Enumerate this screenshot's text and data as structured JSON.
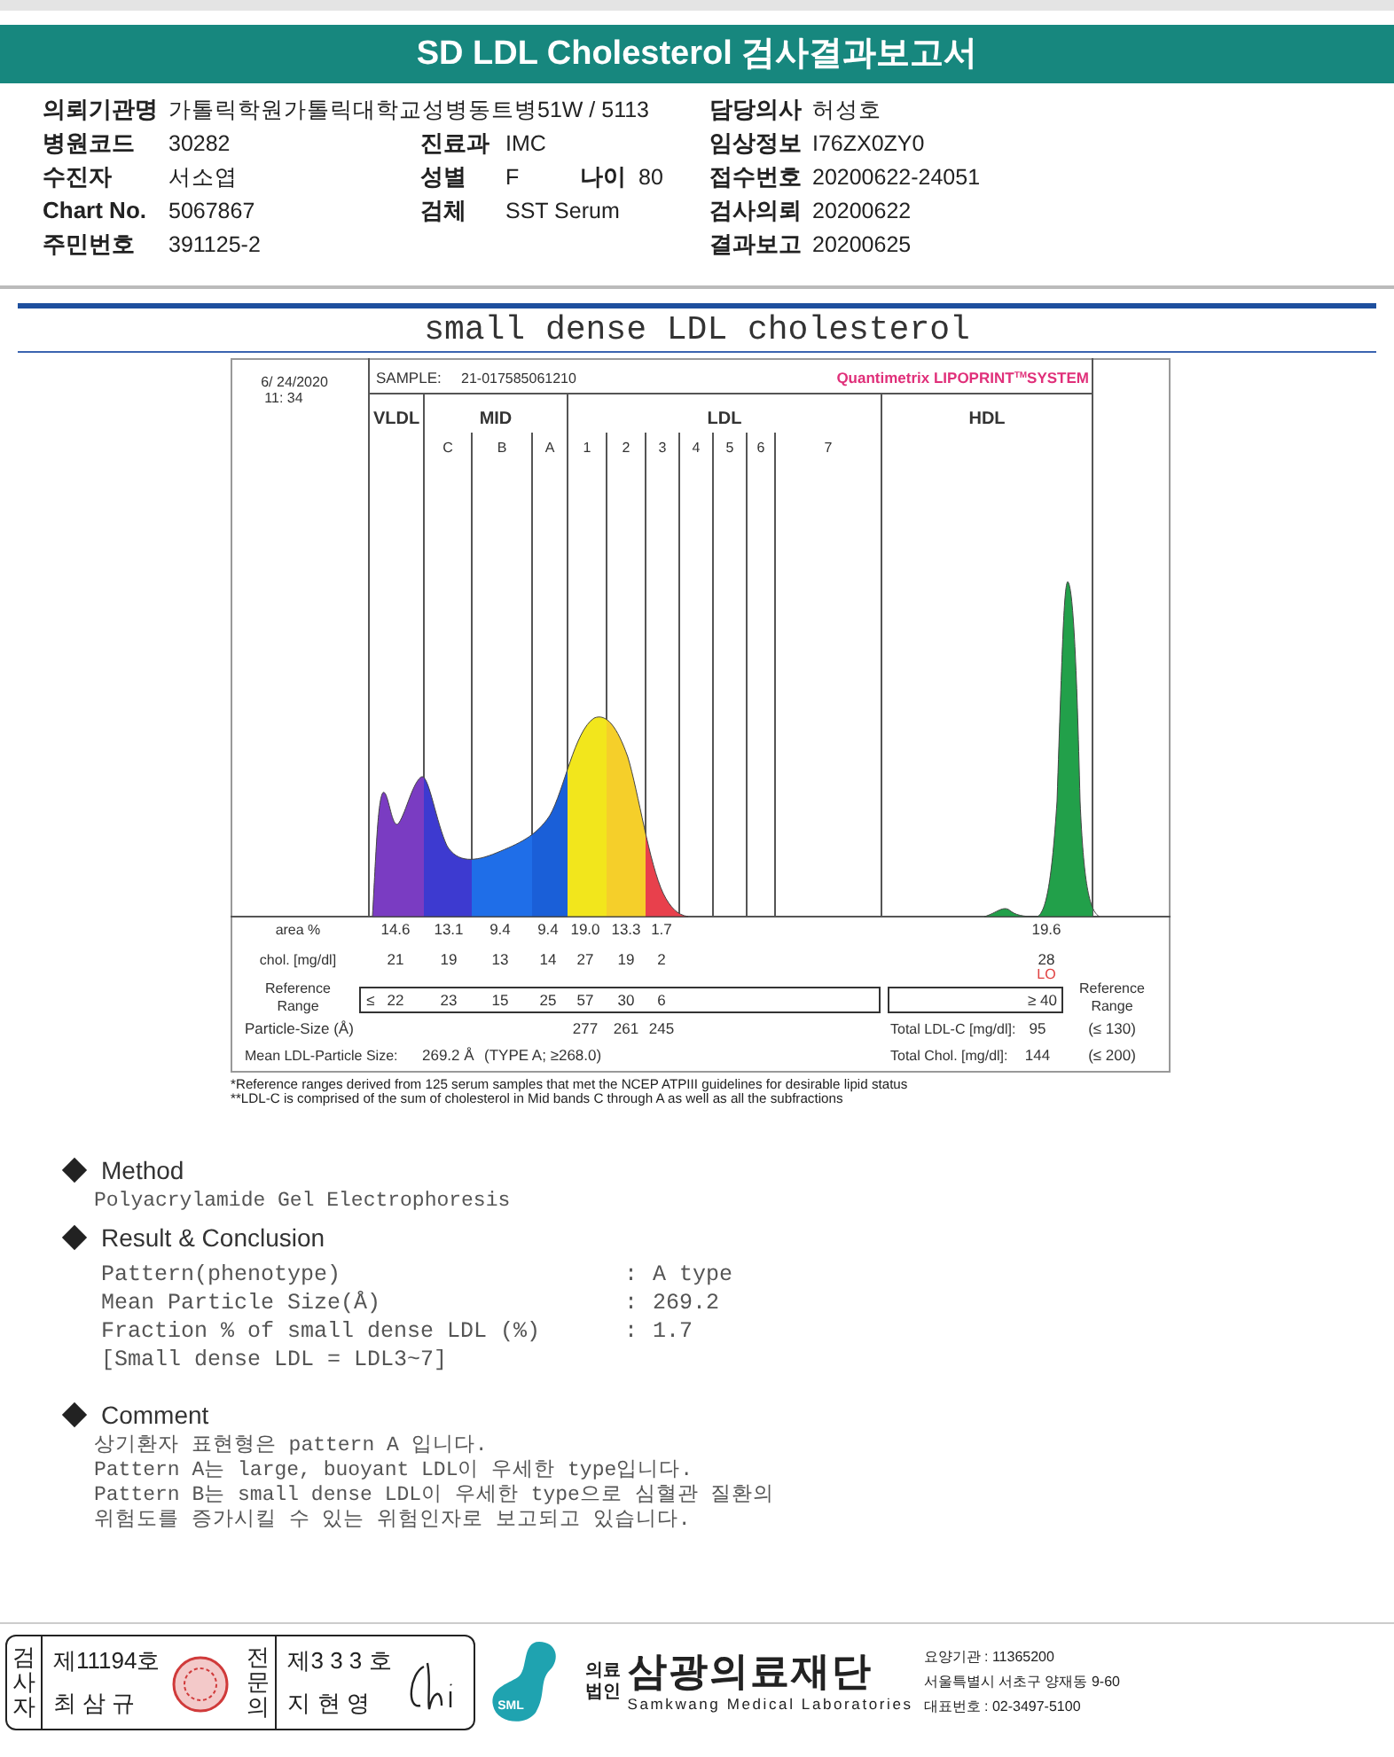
{
  "header": {
    "title": "SD LDL Cholesterol 검사결과보고서"
  },
  "info_rows": [
    {
      "left": {
        "label": "의뢰기관명",
        "value": "가톨릭학원가톨릭대학교성병동트병51W / 5113"
      },
      "right": {
        "label": "담당의사",
        "value": "허성호"
      }
    },
    {
      "left": {
        "label": "병원코드",
        "value": "30282"
      },
      "middle": {
        "label": "진료과",
        "value": "IMC"
      },
      "right": {
        "label": "임상정보",
        "value": "I76ZX0ZY0"
      }
    },
    {
      "left": {
        "label": "수진자",
        "value": "서소엽"
      },
      "middle": {
        "label": "성별",
        "value": "F",
        "extra_label": "나이",
        "extra_value": "80"
      },
      "right": {
        "label": "접수번호",
        "value": "20200622-24051"
      }
    },
    {
      "left": {
        "label": "Chart No.",
        "value": "5067867"
      },
      "middle": {
        "label": "검체",
        "value": "SST Serum"
      },
      "right": {
        "label": "검사의뢰",
        "value": "20200622"
      }
    },
    {
      "left": {
        "label": "주민번호",
        "value": "391125-2"
      },
      "right": {
        "label": "결과보고",
        "value": "20200625"
      }
    }
  ],
  "report_title": "small dense LDL cholesterol",
  "electropherogram": {
    "date": "6/ 24/2020",
    "time": "11: 34",
    "sample_label": "SAMPLE:",
    "sample_id": "21-017585061210",
    "system": "Quantimetrix LIPOPRINT$^{TM}$SYSTEM",
    "groups": [
      {
        "label": "VLDL"
      },
      {
        "label": "MID",
        "bands": [
          "C",
          "B",
          "A"
        ]
      },
      {
        "label": "LDL",
        "bands": [
          "1",
          "2",
          "3",
          "4",
          "5",
          "6",
          "7"
        ]
      },
      {
        "label": "HDL"
      }
    ],
    "rows": [
      {
        "kind": "plain",
        "label": "area %",
        "values": [
          "14.6",
          "13.1",
          "9.4",
          "9.4",
          "19.0",
          "13.3",
          "1.7"
        ],
        "hdl": "19.6"
      },
      {
        "kind": "plain",
        "label": "chol. [mg/dl]",
        "values": [
          "21",
          "19",
          "13",
          "14",
          "27",
          "19",
          "2"
        ],
        "hdl": "28",
        "hdl_flag": "LO"
      },
      {
        "kind": "range",
        "label": "Reference Range",
        "prefix": "≤",
        "values": [
          "22",
          "23",
          "15",
          "25",
          "57",
          "30",
          "6"
        ],
        "hdl": "≥ 40",
        "right_label": "Reference Range"
      },
      {
        "kind": "ldl",
        "label": "Particle-Size (Å)",
        "values": [
          "277",
          "261",
          "245"
        ]
      }
    ],
    "mean": {
      "label": "Mean LDL-Particle Size:",
      "value": "269.2 Å",
      "note": "(TYPE A; ≥268.0)"
    },
    "totals": [
      {
        "label": "Total LDL-C [mg/dl]:",
        "value": "95",
        "range": "(≤ 130)"
      },
      {
        "label": "Total Chol. [mg/dl]:",
        "value": "144",
        "range": "(≤ 200)"
      }
    ],
    "footnotes": [
      "*Reference ranges derived from 125 serum samples that met the NCEP ATPIII guidelines for desirable lipid status",
      "**LDL-C is comprised of the sum of cholesterol in Mid bands C through A as well as all the subfractions"
    ]
  },
  "sections": [
    {
      "kind": "text",
      "heading": "Method",
      "lines": [
        "Polyacrylamide Gel Electrophoresis"
      ]
    },
    {
      "kind": "results",
      "heading": "Result & Conclusion",
      "rows": [
        {
          "label": "Pattern(phenotype)",
          "colon": ":",
          "value": "A type"
        },
        {
          "label": "Mean Particle Size(Å)",
          "colon": ":",
          "value": "269.2"
        },
        {
          "label": "Fraction % of small dense LDL (%)",
          "colon": ":",
          "value": "1.7"
        }
      ],
      "note": "[Small dense LDL = LDL3~7]"
    },
    {
      "kind": "text",
      "heading": "Comment",
      "lines": [
        "상기환자 표현형은 pattern A 입니다.",
        "Pattern A는 large, buoyant LDL이 우세한 type입니다.",
        "Pattern B는 small dense LDL이 우세한 type으로 심혈관 질환의",
        "위험도를 증가시킬 수 있는 위험인자로 보고되고 있습니다."
      ]
    }
  ],
  "footer": {
    "signers": [
      {
        "role": "검사자",
        "number": "제11194호",
        "name": "최 삼 규"
      },
      {
        "role": "전문의",
        "number": "제3 3 3 호",
        "name": "지 현 영"
      }
    ],
    "logo_text": "SML",
    "corp_type": [
      "의료",
      "법인"
    ],
    "org_name": "삼광의료재단",
    "org_name_en": "Samkwang Medical Laboratories",
    "details": [
      "요양기관 : 11365200",
      "서울특별시 서초구 양재동 9-60",
      "대표번호 : 02-3497-5100"
    ]
  }
}
